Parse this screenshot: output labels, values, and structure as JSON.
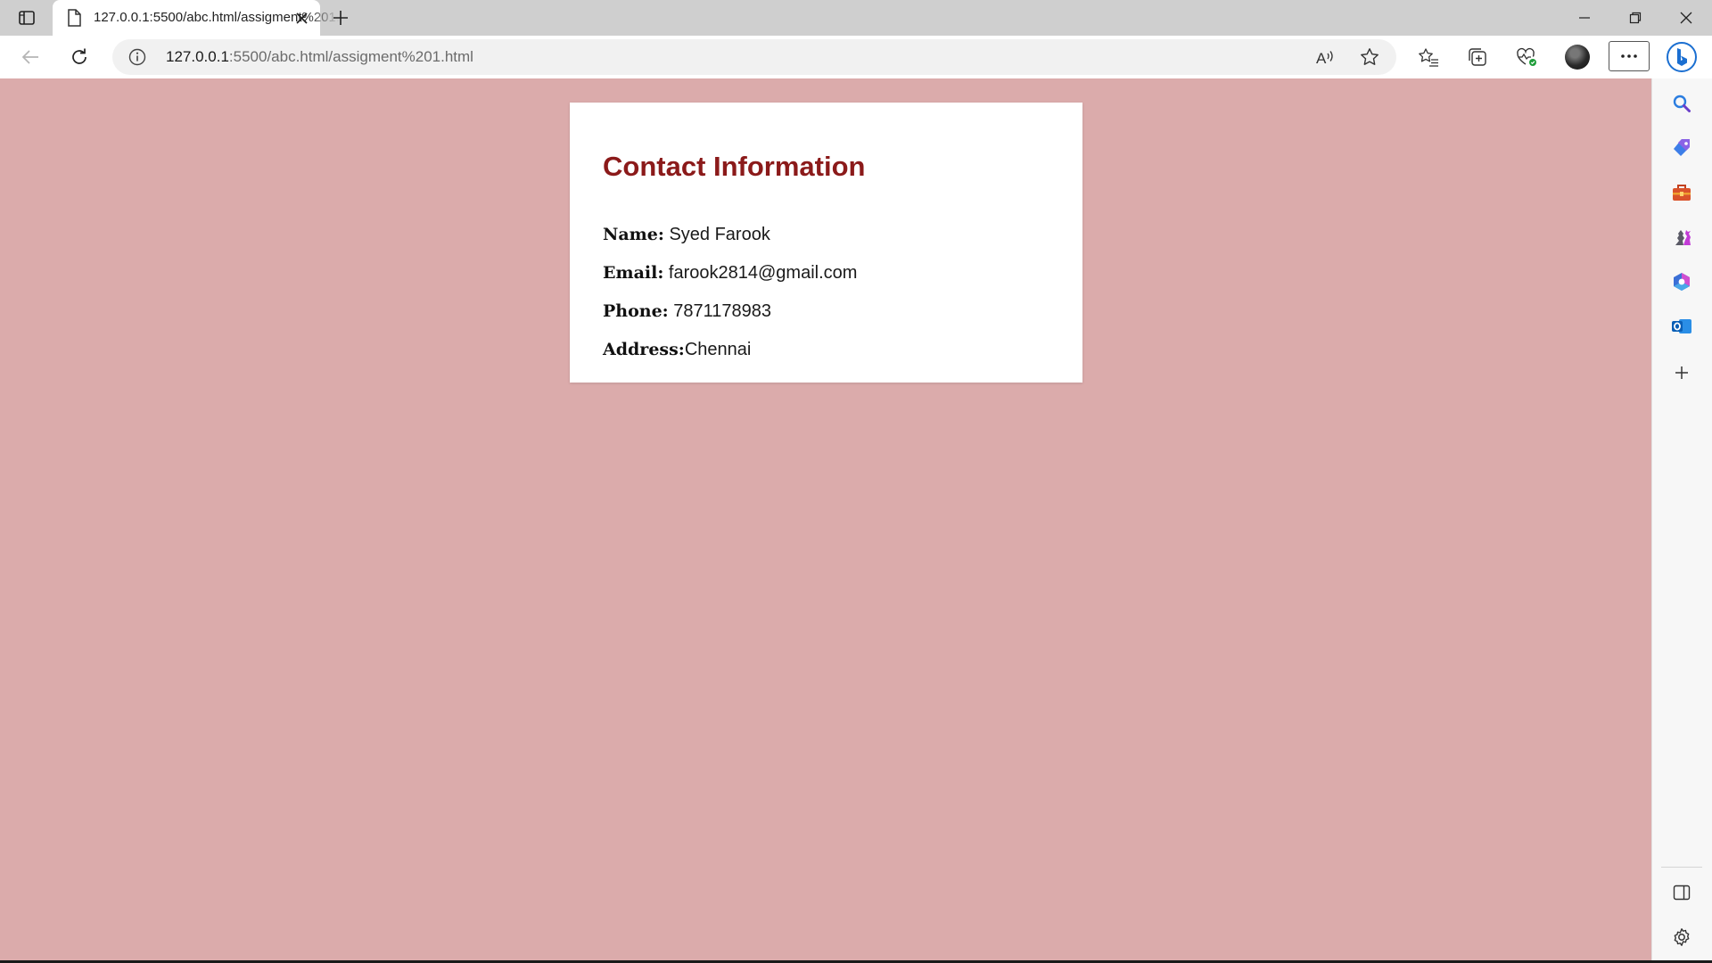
{
  "browser": {
    "tab": {
      "title": "127.0.0.1:5500/abc.html/assigment%201.html"
    },
    "address": {
      "host": "127.0.0.1",
      "rest": ":5500/abc.html/assigment%201.html"
    },
    "icons": {
      "tab_actions": "tab-actions-icon",
      "tab_favicon": "document-icon",
      "tab_close": "close-icon",
      "new_tab": "plus-icon",
      "minimize": "minimize-icon",
      "restore": "restore-icon",
      "close_window": "close-icon",
      "back": "back-arrow-icon",
      "refresh": "refresh-icon",
      "site_info": "info-icon",
      "read_aloud": "read-aloud-icon",
      "favorite": "star-icon",
      "favorites": "favorites-icon",
      "collections": "collections-icon",
      "browser_essentials": "heart-pulse-icon",
      "profile": "avatar",
      "more": "ellipsis-icon",
      "copilot": "bing-icon"
    }
  },
  "sidebar": {
    "items": [
      {
        "name": "search-icon"
      },
      {
        "name": "shopping-tag-icon"
      },
      {
        "name": "tools-icon"
      },
      {
        "name": "games-icon"
      },
      {
        "name": "microsoft-365-icon"
      },
      {
        "name": "outlook-icon"
      },
      {
        "name": "add-icon"
      }
    ],
    "bottom": [
      {
        "name": "hide-sidebar-icon"
      },
      {
        "name": "settings-icon"
      }
    ]
  },
  "page": {
    "background": "#dbabab",
    "heading_color": "#8b1a1a",
    "card": {
      "title": "Contact Information",
      "rows": [
        {
          "label": "Name:",
          "value": " Syed Farook"
        },
        {
          "label": "Email:",
          "value": " farook2814@gmail.com"
        },
        {
          "label": "Phone:",
          "value": " 7871178983"
        },
        {
          "label": "Address:",
          "value": "Chennai"
        }
      ]
    }
  }
}
